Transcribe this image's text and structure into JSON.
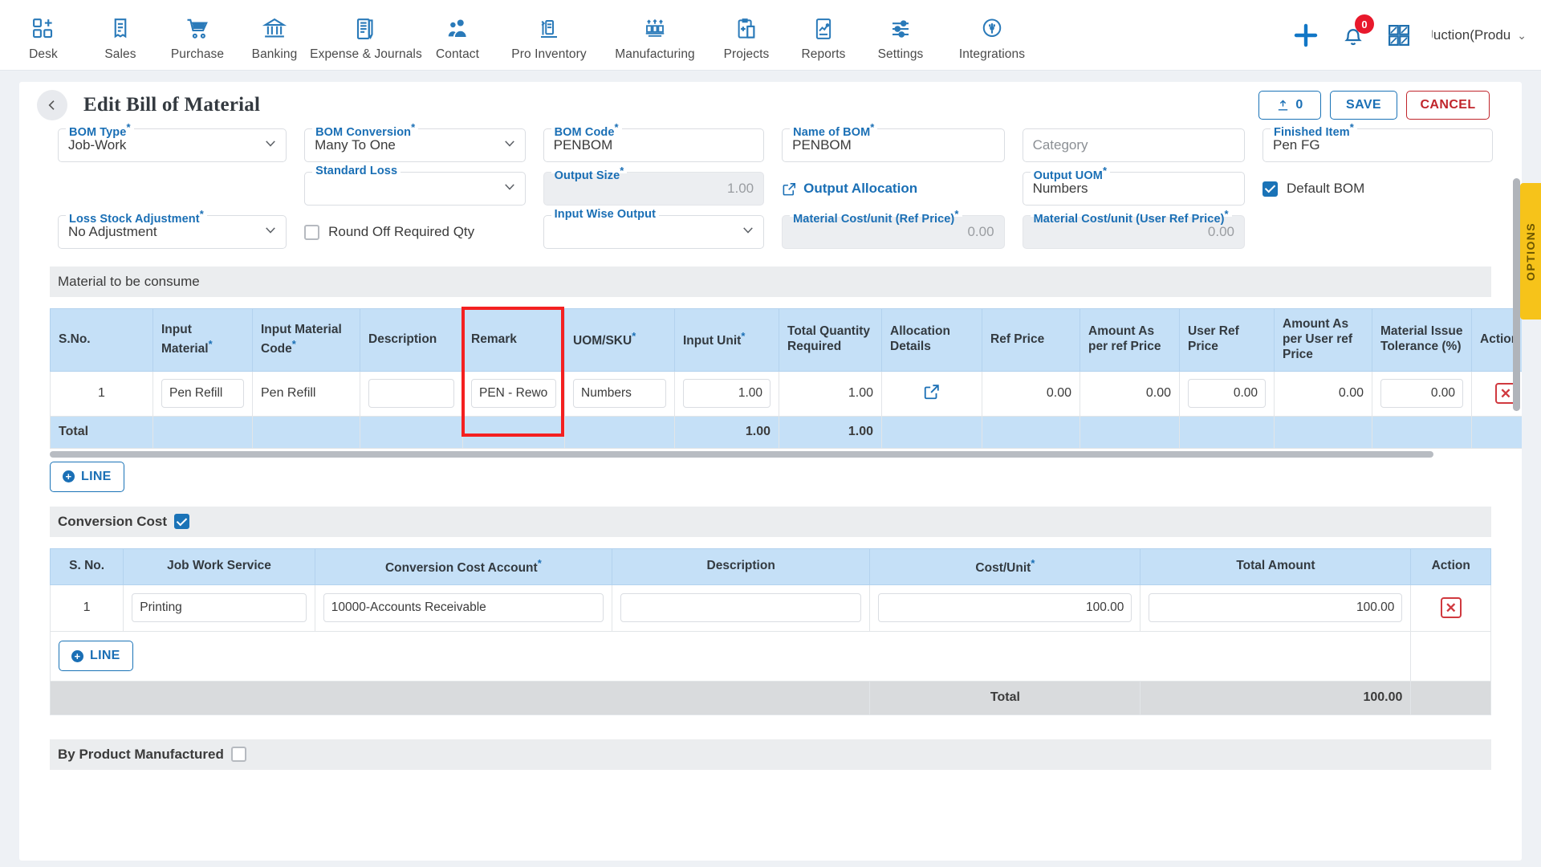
{
  "topnav": {
    "items": [
      {
        "label": "Desk",
        "icon": "desk-icon"
      },
      {
        "label": "Sales",
        "icon": "sales-icon"
      },
      {
        "label": "Purchase",
        "icon": "purchase-cart-icon"
      },
      {
        "label": "Banking",
        "icon": "bank-icon"
      },
      {
        "label": "Expense & Journals",
        "icon": "journal-icon"
      },
      {
        "label": "Contact",
        "icon": "contact-people-icon"
      },
      {
        "label": "Pro Inventory",
        "icon": "inventory-icon"
      },
      {
        "label": "Manufacturing",
        "icon": "manufacturing-icon"
      },
      {
        "label": "Projects",
        "icon": "projects-clipboard-icon"
      },
      {
        "label": "Reports",
        "icon": "reports-chart-icon"
      },
      {
        "label": "Settings",
        "icon": "settings-sliders-icon"
      },
      {
        "label": "Integrations",
        "icon": "integrations-plug-icon"
      }
    ],
    "add_icon": "plus-icon",
    "notification_icon": "bell-icon",
    "notification_count": "0",
    "apps_icon": "grid-apps-icon",
    "org_name": "Juction(Produ",
    "org_caret": "chevron-down-icon"
  },
  "header": {
    "back_icon": "chevron-left-icon",
    "title": "Edit Bill of Material",
    "attach_label": "0",
    "attach_icon": "upload-icon",
    "save_label": "SAVE",
    "cancel_label": "CANCEL"
  },
  "form": {
    "bom_type": {
      "label": "BOM Type",
      "required": true,
      "value": "Job-Work"
    },
    "bom_conversion": {
      "label": "BOM Conversion",
      "required": true,
      "value": "Many To One"
    },
    "bom_code": {
      "label": "BOM Code",
      "required": true,
      "value": "PENBOM"
    },
    "name_of_bom": {
      "label": "Name of BOM",
      "required": true,
      "value": "PENBOM"
    },
    "category": {
      "label": "",
      "required": false,
      "placeholder": "Category",
      "value": ""
    },
    "finished_item": {
      "label": "Finished Item",
      "required": true,
      "value": "Pen FG"
    },
    "standard_loss": {
      "label": "Standard Loss",
      "required": false,
      "value": ""
    },
    "output_size": {
      "label": "Output Size",
      "required": true,
      "value": "1.00"
    },
    "output_allocation": {
      "label": "Output Allocation",
      "icon": "external-link-icon"
    },
    "output_uom": {
      "label": "Output UOM",
      "required": true,
      "value": "Numbers"
    },
    "default_bom": {
      "label": "Default BOM",
      "checked": true
    },
    "loss_stock_adjustment": {
      "label": "Loss Stock Adjustment",
      "required": true,
      "value": "No Adjustment"
    },
    "round_off": {
      "label": "Round Off Required Qty",
      "checked": false
    },
    "input_wise_output": {
      "label": "Input Wise Output",
      "required": false,
      "value": ""
    },
    "material_cost_ref": {
      "label": "Material Cost/unit (Ref Price)",
      "required": true,
      "value": "0.00"
    },
    "material_cost_user_ref": {
      "label": "Material Cost/unit (User Ref Price)",
      "required": true,
      "value": "0.00"
    }
  },
  "material_section": {
    "title": "Material to be consume",
    "columns": [
      {
        "label": "S.No.",
        "required": false
      },
      {
        "label": "Input Material",
        "required": true
      },
      {
        "label": "Input Material Code",
        "required": true
      },
      {
        "label": "Description",
        "required": false
      },
      {
        "label": "Remark",
        "required": false
      },
      {
        "label": "UOM/SKU",
        "required": true
      },
      {
        "label": "Input Unit",
        "required": true
      },
      {
        "label": "Total Quantity Required",
        "required": false
      },
      {
        "label": "Allocation Details",
        "required": false
      },
      {
        "label": "Ref Price",
        "required": false
      },
      {
        "label": "Amount As per ref Price",
        "required": false
      },
      {
        "label": "User Ref Price",
        "required": false
      },
      {
        "label": "Amount As per User ref Price",
        "required": false
      },
      {
        "label": "Material Issue Tolerance (%)",
        "required": false
      },
      {
        "label": "Action",
        "required": false
      }
    ],
    "rows": [
      {
        "sno": "1",
        "input_material": "Pen Refill",
        "input_material_code": "Pen Refill",
        "description": "",
        "remark": "PEN - Rewo",
        "uom_sku": "Numbers",
        "input_unit": "1.00",
        "total_qty_required": "1.00",
        "allocation_icon": "external-link-icon",
        "ref_price": "0.00",
        "amount_ref_price": "0.00",
        "user_ref_price": "0.00",
        "amount_user_ref_price": "0.00",
        "material_issue_tolerance": "0.00",
        "action_icon": "delete-x-icon"
      }
    ],
    "total": {
      "label": "Total",
      "input_unit": "1.00",
      "total_qty_required": "1.00"
    },
    "add_line_label": "LINE",
    "add_line_icon": "plus-circle-icon"
  },
  "conversion_cost": {
    "title": "Conversion Cost",
    "checked": true,
    "columns": [
      {
        "label": "S. No.",
        "required": false
      },
      {
        "label": "Job Work Service",
        "required": false
      },
      {
        "label": "Conversion Cost Account",
        "required": true
      },
      {
        "label": "Description",
        "required": false
      },
      {
        "label": "Cost/Unit",
        "required": true
      },
      {
        "label": "Total Amount",
        "required": false
      },
      {
        "label": "Action",
        "required": false
      }
    ],
    "rows": [
      {
        "sno": "1",
        "job_work_service": "Printing",
        "conversion_cost_account": "10000-Accounts Receivable",
        "description": "",
        "cost_per_unit": "100.00",
        "total_amount": "100.00",
        "action_icon": "delete-x-icon"
      }
    ],
    "total": {
      "label": "Total",
      "amount": "100.00"
    },
    "add_line_label": "LINE",
    "add_line_icon": "plus-circle-icon"
  },
  "by_product": {
    "title": "By Product Manufactured",
    "checked": false
  },
  "options_tab": {
    "label": "OPTIONS"
  },
  "colors": {
    "accent_blue": "#1a6fb5",
    "danger_red": "#c0252b",
    "highlight_red": "#f42020",
    "table_header_blue": "#c5e0f7",
    "options_yellow": "#f6c31a"
  }
}
